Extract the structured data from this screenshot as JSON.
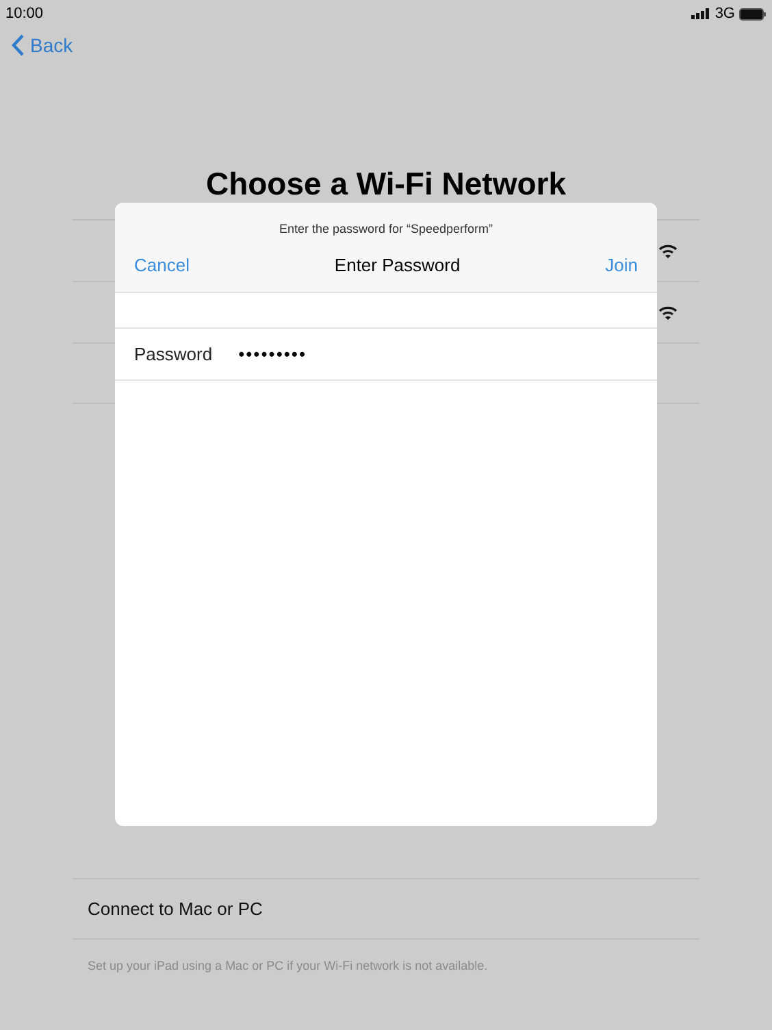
{
  "status_bar": {
    "time": "10:00",
    "network": "3G"
  },
  "nav": {
    "back_label": "Back"
  },
  "title": "Choose a Wi-Fi Network",
  "networks": [
    {
      "signal": true
    },
    {
      "signal": true
    }
  ],
  "connect_option": "Connect to Mac or PC",
  "footnote": "Set up your iPad using a Mac or PC if your Wi-Fi network is not available.",
  "dialog": {
    "prompt": "Enter the password for “Speedperform”",
    "title": "Enter Password",
    "cancel": "Cancel",
    "join": "Join",
    "field_label": "Password",
    "field_value": "•••••••••"
  }
}
